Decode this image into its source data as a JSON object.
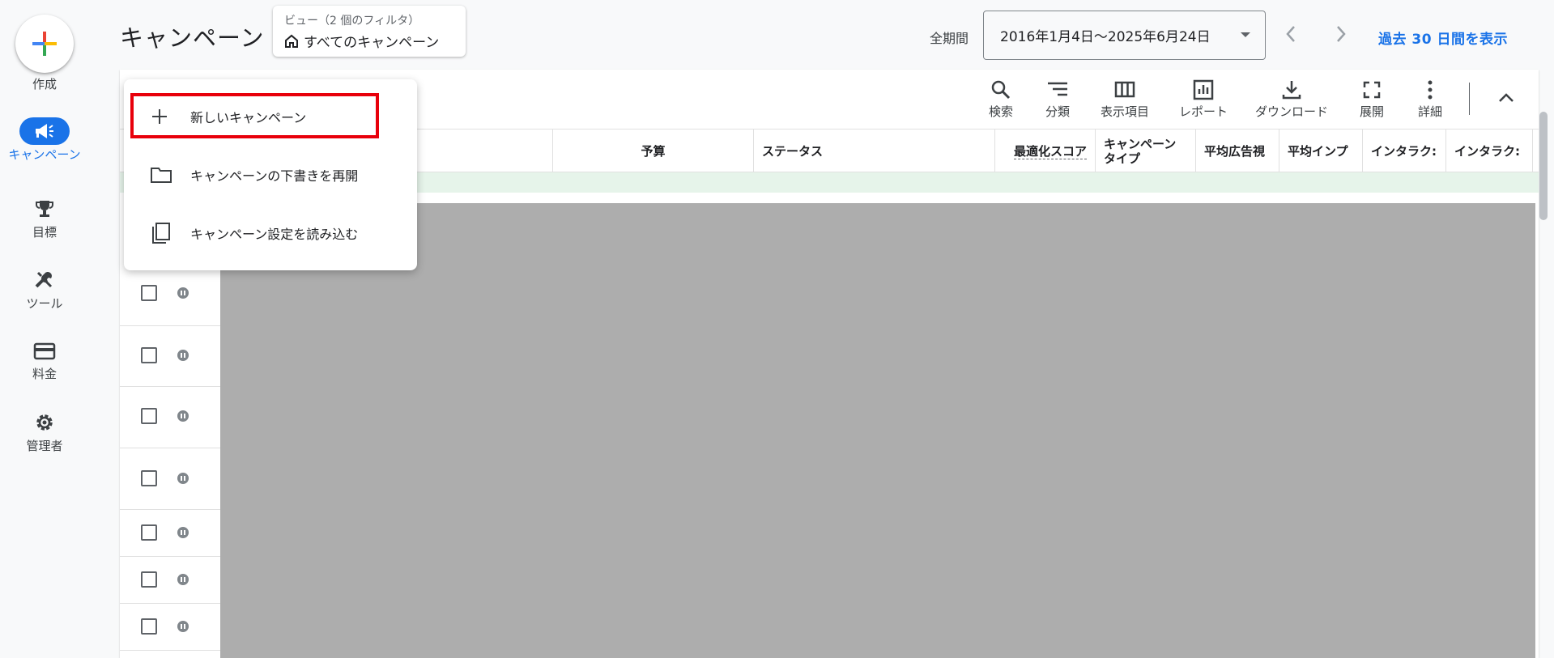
{
  "nav": {
    "create_label": "作成",
    "items": [
      {
        "label": "キャンペーン",
        "icon": "megaphone-icon",
        "active": true
      },
      {
        "label": "目標",
        "icon": "trophy-icon"
      },
      {
        "label": "ツール",
        "icon": "tools-icon"
      },
      {
        "label": "料金",
        "icon": "credit-card-icon"
      },
      {
        "label": "管理者",
        "icon": "gear-icon"
      }
    ]
  },
  "header": {
    "title": "キャンペーン",
    "view_subtitle": "ビュー（2 個のフィルタ）",
    "view_name": "すべてのキャンペーン",
    "period_label": "全期間",
    "date_range": "2016年1月4日〜2025年6月24日",
    "show_recent": "過去 30 日間を表示"
  },
  "toolbar": {
    "search": "検索",
    "segment": "分類",
    "columns": "表示項目",
    "reports": "レポート",
    "download": "ダウンロード",
    "expand": "展開",
    "more": "詳細"
  },
  "table": {
    "headers": {
      "budget": "予算",
      "status": "ステータス",
      "opt_score": "最適化スコア",
      "campaign_type_1": "キャンペーン",
      "campaign_type_2": "タイプ",
      "avg_viewable": "平均広告視",
      "avg_imp": "平均インプ",
      "interactions_1": "インタラク:",
      "interactions_2": "インタラク:"
    }
  },
  "menu": {
    "items": [
      {
        "label": "新しいキャンペーン",
        "icon": "plus-icon"
      },
      {
        "label": "キャンペーンの下書きを再開",
        "icon": "folder-icon"
      },
      {
        "label": "キャンペーン設定を読み込む",
        "icon": "copy-icon"
      }
    ]
  },
  "colors": {
    "accent": "#1a73e8",
    "highlight_border": "#e8000b",
    "row_green": "#e6f4ea"
  }
}
